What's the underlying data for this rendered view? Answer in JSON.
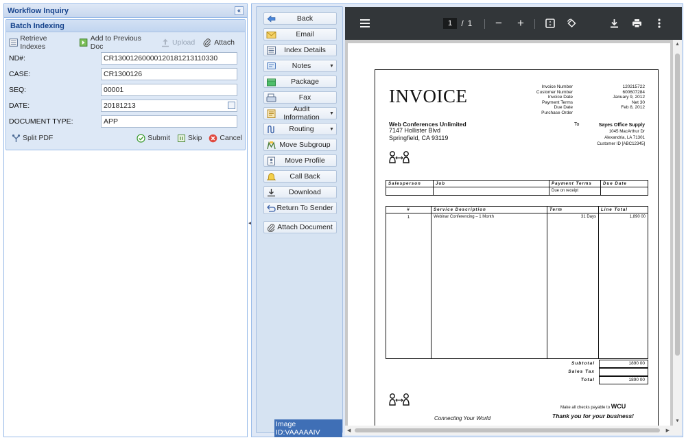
{
  "left_panel": {
    "title": "Workflow Inquiry",
    "collapse_glyph": "«",
    "batch": {
      "title": "Batch Indexing",
      "toolbar": {
        "retrieve": "Retrieve Indexes",
        "add_prev": "Add to Previous Doc",
        "upload": "Upload",
        "attach": "Attach"
      },
      "fields": {
        "nd_label": "ND#:",
        "nd_value": "CR13001260000120181213110330",
        "case_label": "CASE:",
        "case_value": "CR1300126",
        "seq_label": "SEQ:",
        "seq_value": "00001",
        "date_label": "DATE:",
        "date_value": "20181213",
        "doctype_label": "DOCUMENT TYPE:",
        "doctype_value": "APP"
      },
      "bottom": {
        "split_pdf": "Split PDF",
        "submit": "Submit",
        "skip": "Skip",
        "cancel": "Cancel"
      }
    }
  },
  "actions": [
    {
      "label": "Back",
      "icon": "arrow-left-icon",
      "dropdown": false
    },
    {
      "label": "Email",
      "icon": "envelope-icon",
      "dropdown": false
    },
    {
      "label": "Index Details",
      "icon": "list-icon",
      "dropdown": false
    },
    {
      "label": "Notes",
      "icon": "notes-icon",
      "dropdown": true
    },
    {
      "label": "Package",
      "icon": "package-icon",
      "dropdown": false
    },
    {
      "label": "Fax",
      "icon": "fax-icon",
      "dropdown": false
    },
    {
      "label": "Audit Information",
      "icon": "audit-icon",
      "dropdown": true
    },
    {
      "label": "Routing",
      "icon": "routing-icon",
      "dropdown": true
    },
    {
      "label": "Move Subgroup",
      "icon": "move-subgroup-icon",
      "dropdown": false
    },
    {
      "label": "Move Profile",
      "icon": "move-profile-icon",
      "dropdown": false
    },
    {
      "label": "Call Back",
      "icon": "bell-icon",
      "dropdown": false
    },
    {
      "label": "Download",
      "icon": "download-icon",
      "dropdown": false
    },
    {
      "label": "Return To Sender",
      "icon": "return-icon",
      "dropdown": false
    },
    {
      "label": "Attach Document",
      "icon": "paperclip-icon",
      "dropdown": false
    }
  ],
  "image_id": "Image ID:VAAAAAIV",
  "pdf_toolbar": {
    "current_page": "1",
    "page_sep": "/",
    "total_pages": "1",
    "zoom_out": "−",
    "zoom_in": "+"
  },
  "invoice": {
    "title": "INVOICE",
    "meta_labels": [
      "Invoice Number",
      "Customer Number",
      "Invoice Date",
      "Payment Terms",
      "Due Date",
      "Purchase Order"
    ],
    "meta_values": [
      "120215722",
      "600607284",
      "January 9, 2012",
      "Net 30",
      "Feb 8, 2012",
      ""
    ],
    "from_name": "Web Conferences Unlimited",
    "from_addr1": "7147 Hollister Blvd",
    "from_addr2": "Springfield, CA  93119",
    "to_label": "To",
    "to_name": "Sayes Office Supply",
    "to_addr1": "1045 MacArthur Dr",
    "to_addr2": "Alexandria, LA 71301",
    "to_cust": "Customer ID [ABC12345]",
    "head_table": {
      "cols": [
        "Salesperson",
        "Job",
        "Payment Terms",
        "Due Date"
      ],
      "row": [
        "",
        "",
        "Due on receipt",
        ""
      ]
    },
    "line_table": {
      "cols": [
        "#",
        "Service Description",
        "Term",
        "Line Total"
      ],
      "rows": [
        [
          "1",
          "Webinar Conferencing – 1 Month",
          "31 Days",
          "1,890 00"
        ]
      ]
    },
    "subtotal_label": "Subtotal",
    "subtotal_value": "1890 00",
    "tax_label": "Sales Tax",
    "tax_value": "",
    "total_label": "Total",
    "total_value": "1890 00",
    "payable_text": "Make all checks payable to",
    "payable_name": "WCU",
    "thanks": "Thank you for your business!",
    "tagline": "Connecting Your World"
  },
  "colors": {
    "accent": "#15428b",
    "panel_border": "#99bbe8",
    "pdf_toolbar": "#323639",
    "selection": "#3f6fb6"
  }
}
